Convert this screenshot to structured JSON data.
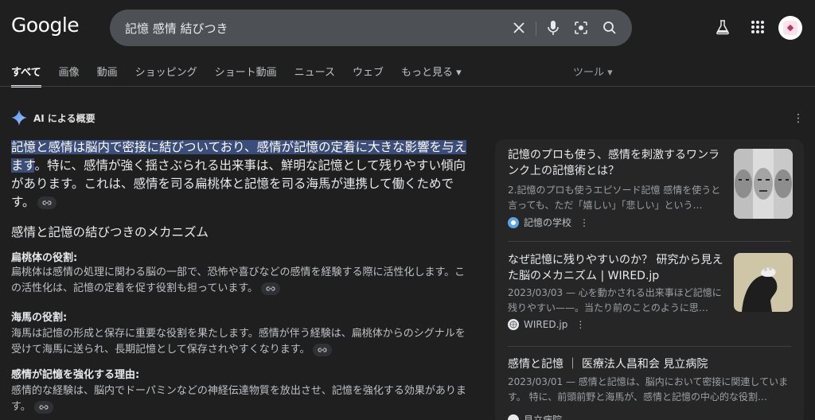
{
  "header": {
    "logo": "Google",
    "query": "記憶 感情 結びつき"
  },
  "tabs": [
    "すべて",
    "画像",
    "動画",
    "ショッピング",
    "ショート動画",
    "ニュース",
    "ウェブ",
    "もっと見る ▾"
  ],
  "tools_label": "ツール ▾",
  "ai": {
    "label": "AI による概要",
    "main_highlight": "記憶と感情は脳内で密接に結びついており、感情が記憶の定着に大きな影響を与えます",
    "main_rest": "。特に、感情が強く揺さぶられる出来事は、鮮明な記憶として残りやすい傾向があります。これは、感情を司る扁桃体と記憶を司る海馬が連携して働くためです。",
    "section_title": "感情と記憶の結びつきのメカニズム",
    "items": [
      {
        "title": "扁桃体の役割:",
        "text": "扁桃体は感情の処理に関わる脳の一部で、恐怖や喜びなどの感情を経験する際に活性化します。この活性化は、記憶の定着を促す役割も担っています。"
      },
      {
        "title": "海馬の役割:",
        "text": "海馬は記憶の形成と保存に重要な役割を果たします。感情が伴う経験は、扁桃体からのシグナルを受けて海馬に送られ、長期記憶として保存されやすくなります。"
      },
      {
        "title": "感情が記憶を強化する理由:",
        "text": "感情的な経験は、脳内でドーパミンなどの神経伝達物質を放出させ、記憶を強化する効果があります。"
      }
    ]
  },
  "cards": [
    {
      "title": "記憶のプロも使う、感情を刺激するワンランク上の記憶術とは？",
      "snippet": "2.記憶のプロも使うエピソード記憶 感情を使うと言っても、ただ「嬉しい」「悲しい」という…",
      "source": "記憶の学校"
    },
    {
      "title": "なぜ記憶に残りやすいのか？ 研究から見えた脳のメカニズム | WIRED.jp",
      "snippet": "2023/03/03 — 心を動かされる出来事ほど記憶に残りやすい——。当たり前のことのように思…",
      "source": "WIRED.jp"
    },
    {
      "title": "感情と記憶 ｜ 医療法人昌和会 見立病院",
      "snippet": "2023/03/01 — 感情と記憶は、脳内において密接に関連しています。 特に、前頭前野と海馬が、感情と記憶の中心的な役割…",
      "source": "見立病院"
    }
  ]
}
